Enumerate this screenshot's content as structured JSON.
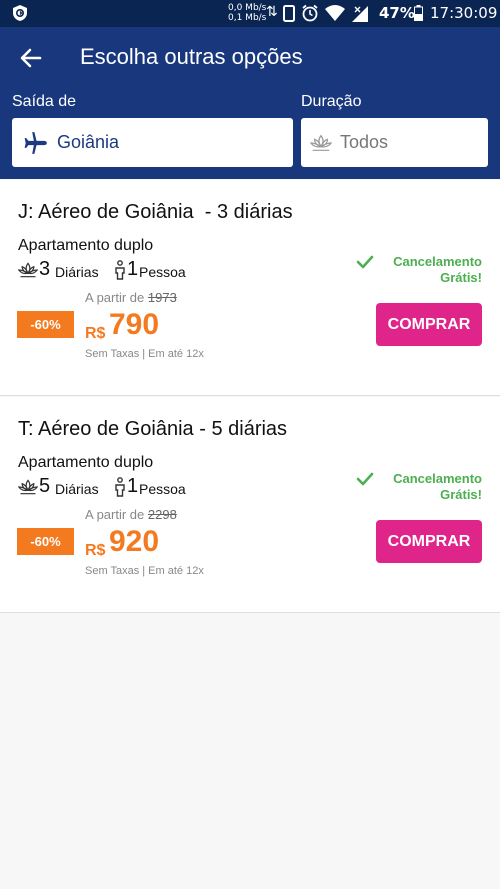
{
  "status_bar": {
    "net_up": "0,0 Mb/s",
    "net_down": "0,1 Mb/s",
    "battery": "47%",
    "time": "17:30:09"
  },
  "header": {
    "title": "Escolha outras opções",
    "departure_label": "Saída de",
    "departure_value": "Goiânia",
    "duration_label": "Duração",
    "duration_value": "Todos"
  },
  "packages": [
    {
      "title": "J: Aéreo de Goiânia  - 3 diárias",
      "room": "Apartamento duplo",
      "nights": "3",
      "nights_label": "Diárias",
      "people": "1",
      "people_label": "Pessoa",
      "cancel_line1": "Cancelamento",
      "cancel_line2": "Grátis!",
      "from_label": "A partir de",
      "old_price": "1973",
      "discount": "-60%",
      "currency": "R$",
      "price": "790",
      "tax_note": "Sem Taxas | Em até 12x",
      "buy_label": "COMPRAR"
    },
    {
      "title": "T: Aéreo de Goiânia - 5 diárias",
      "room": "Apartamento duplo",
      "nights": "5",
      "nights_label": "Diárias",
      "people": "1",
      "people_label": "Pessoa",
      "cancel_line1": "Cancelamento",
      "cancel_line2": "Grátis!",
      "from_label": "A partir de",
      "old_price": "2298",
      "discount": "-60%",
      "currency": "R$",
      "price": "920",
      "tax_note": "Sem Taxas | Em até 12x",
      "buy_label": "COMPRAR"
    }
  ],
  "colors": {
    "status_bar": "#0b2552",
    "header": "#18377d",
    "accent_orange": "#f47a20",
    "buy_button": "#e0258a",
    "cancel_green": "#4caf50"
  }
}
